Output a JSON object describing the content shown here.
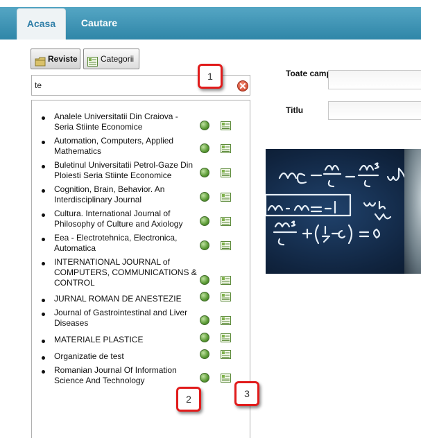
{
  "tabs": [
    {
      "label": "Acasa",
      "active": true
    },
    {
      "label": "Cautare",
      "active": false
    }
  ],
  "toggle": {
    "reviste_label": "Reviste",
    "categorii_label": "Categorii"
  },
  "search": {
    "value": "te"
  },
  "journals": [
    {
      "title": "Analele Universitatii Din Craiova - Seria Stiinte Economice"
    },
    {
      "title": "Automation, Computers, Applied Mathematics"
    },
    {
      "title": "Buletinul Universitatii Petrol-Gaze Din Ploiesti Seria Stiinte Economice"
    },
    {
      "title": "Cognition, Brain, Behavior. An Interdisciplinary Journal"
    },
    {
      "title": "Cultura. International Journal of Philosophy of Culture and Axiology"
    },
    {
      "title": "Eea - Electrotehnica, Electronica, Automatica"
    },
    {
      "title": "INTERNATIONAL JOURNAL of COMPUTERS, COMMUNICATIONS & CONTROL"
    },
    {
      "title": "JURNAL ROMAN DE ANESTEZIE"
    },
    {
      "title": "Journal of Gastrointestinal and Liver Diseases"
    },
    {
      "title": "MATERIALE PLASTICE"
    },
    {
      "title": "Organizatie de test"
    },
    {
      "title": "Romanian Journal Of Information Science And Technology"
    }
  ],
  "fields": {
    "toate_label": "Toate campurile",
    "titlu_label": "Titlu"
  },
  "callouts": [
    "1",
    "2",
    "3"
  ],
  "colors": {
    "tabbar": "#3d8fb0",
    "active_tab_text": "#2f7fa8",
    "callout_border": "#e11b1b",
    "globe": "#5a9a34"
  },
  "icons": {
    "reviste": "folder-icon",
    "categorii": "category-icon",
    "clear": "clear-icon",
    "journal_action_1": "globe-icon",
    "journal_action_2": "category-icon"
  }
}
